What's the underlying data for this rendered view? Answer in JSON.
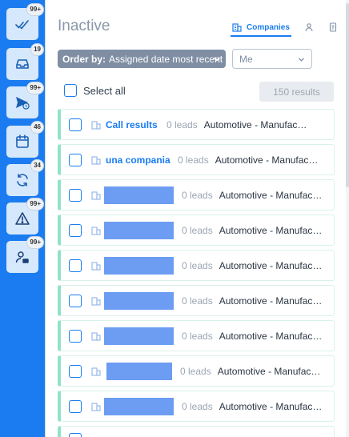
{
  "sidebar": {
    "items": [
      {
        "name": "sidebar-item-tasks",
        "icon": "double-check-icon",
        "badge": "99+"
      },
      {
        "name": "sidebar-item-inbox",
        "icon": "inbox-tray-icon",
        "badge": "19"
      },
      {
        "name": "sidebar-item-sent",
        "icon": "send-clock-icon",
        "badge": "99+"
      },
      {
        "name": "sidebar-item-calendar",
        "icon": "calendar-icon",
        "badge": "46"
      },
      {
        "name": "sidebar-item-reschedule",
        "icon": "refresh-icon",
        "badge": "34"
      },
      {
        "name": "sidebar-item-alerts",
        "icon": "warning-triangle-icon",
        "badge": "99+"
      },
      {
        "name": "sidebar-item-inactive",
        "icon": "user-inactive-icon",
        "badge": "99+"
      }
    ]
  },
  "header": {
    "title": "Inactive",
    "view_tabs": {
      "companies_label": "Companies"
    }
  },
  "filters": {
    "order_by_label": "Order by:",
    "order_by_value": "Assigned date most recent",
    "user_value": "Me"
  },
  "list_controls": {
    "select_all_label": "Select all",
    "results_label": "150 results"
  },
  "rows": [
    {
      "name": "Call results",
      "redacted": false,
      "leads": "0 leads",
      "category": "Automotive - Manufacturing"
    },
    {
      "name": "una compania",
      "redacted": false,
      "leads": "0 leads",
      "category": "Automotive - Manufacturing"
    },
    {
      "name": "",
      "redacted": true,
      "leads": "0 leads",
      "category": "Automotive - Manufacturing"
    },
    {
      "name": "",
      "redacted": true,
      "leads": "0 leads",
      "category": "Automotive - Manufacturing"
    },
    {
      "name": "",
      "redacted": true,
      "leads": "0 leads",
      "category": "Automotive - Manufacturing"
    },
    {
      "name": "",
      "redacted": true,
      "leads": "0 leads",
      "category": "Automotive - Manufacturing"
    },
    {
      "name": "",
      "redacted": true,
      "leads": "0 leads",
      "category": "Automotive - Manufacturing"
    },
    {
      "name": "",
      "redacted": true,
      "leads": "0 leads",
      "category": "Automotive - Manufacturing"
    },
    {
      "name": "",
      "redacted": true,
      "leads": "0 leads",
      "category": "Automotive - Manufacturing"
    }
  ],
  "colors": {
    "sidebar_bg": "#1a7cf0",
    "accent": "#1a7cf0",
    "row_accent": "#8ee3c8",
    "order_by_bg": "#7f8ea3",
    "redaction": "#6c9df2"
  }
}
